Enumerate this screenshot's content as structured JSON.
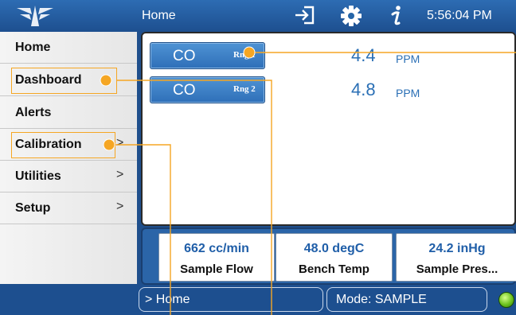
{
  "topbar": {
    "title": "Home",
    "time": "5:56:04 PM",
    "icons": [
      "teledyne-logo-icon",
      "sign-in-icon",
      "gear-icon",
      "info-icon"
    ]
  },
  "sidebar": {
    "items": [
      {
        "label": "Home",
        "chevron": ""
      },
      {
        "label": "Dashboard",
        "chevron": ""
      },
      {
        "label": "Alerts",
        "chevron": ""
      },
      {
        "label": "Calibration",
        "chevron": ">"
      },
      {
        "label": "Utilities",
        "chevron": ">"
      },
      {
        "label": "Setup",
        "chevron": ">"
      }
    ]
  },
  "main": {
    "gases": [
      {
        "name": "CO",
        "range": "Rng 1",
        "value": "4.4",
        "unit": "PPM"
      },
      {
        "name": "CO",
        "range": "Rng 2",
        "value": "4.8",
        "unit": "PPM"
      }
    ]
  },
  "status": {
    "boxes": [
      {
        "value": "662 cc/min",
        "label": "Sample Flow"
      },
      {
        "value": "48.0 degC",
        "label": "Bench Temp"
      },
      {
        "value": "24.2 inHg",
        "label": "Sample Pres..."
      }
    ]
  },
  "footer": {
    "breadcrumb": "> Home",
    "mode": "Mode: SAMPLE",
    "status_color": "#6cc21e"
  },
  "colors": {
    "accent": "#2a6fb5",
    "callout": "#f5a623",
    "bar": "#1d4f8f"
  }
}
